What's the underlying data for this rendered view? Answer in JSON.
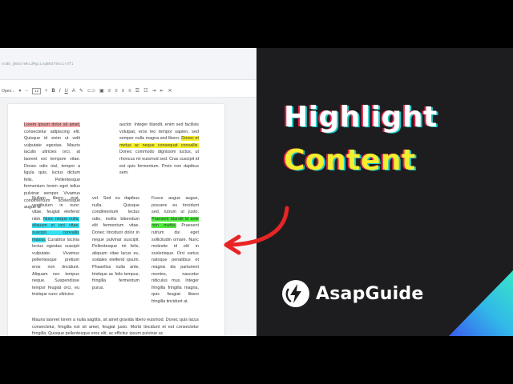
{
  "editor": {
    "url": "ocBE_Q6GorWkLdMgcLsgB0d79Gcir4fi",
    "toolbar": {
      "block_format": "Open...",
      "font_size": "12",
      "bold": "B",
      "italic": "I",
      "underline": "U"
    },
    "paragraphs": {
      "p1_highlight": "Lorem ipsum dolor sit amet,",
      "p1_rest": " consectetur adipiscing elit. Quisque id enim ut velit vulputate egestas. Mauris iaculis ultricies orci, at laoreet est tempore vitae. Donec odio nisl, tempor a ligula quis, luctus dictum felis. Pellentesque fermentum lorem eget tellus pulvinar semper. Vivamus condimentum scelerisque augue id",
      "p2_before": "auctor. Integer blandit, enim sed facilisis volutpat, eros leo tempor sapien, sed semper nulla magna sed libero. ",
      "p2_highlight": "Donec et metus ac neque consequat convallis.",
      "p2_rest": " Donec commodo dignissim luctus, ut rhoncus mi euismod sed. Cras suscipit id est quis fermentum. Proin non dapibus sem.",
      "p3_before": "Nullam libero erat, vestibulum in nunc vitae, feugiat eleifend nibh. ",
      "p3_highlight": "Nunc neque nulla, aliquam et orci vitae, suscipit convallis massa.",
      "p3_rest": " Curabitur lacinia lectus egestas suscipit vulputate. Vivamus pellentesque pretium eros non tincidunt. Aliquam nec tempus neque. Suspendisse tempor feugiat orci, eu tristique nunc ultricies",
      "p4": "vel. Sed eu dapibus nulla. Quisque condimentum lectus odio, mollis bibendum elit fermentum vitae. Donec tincidunt dolor in neque pulvinar suscipit. Pellentesque mi felis, aliquam vitae lacus eu, sodales eleifend ipsum. Phasellus nulla ante, tristique ac felis tempus, fringilla fermentum purus.",
      "p5_before": "Fusce augue augue, posuere eu tincidunt sed, rutrum ut justo. ",
      "p5_highlight": "Praesent blandit id ante non mattis.",
      "p5_rest": " Praesent rutrum dui eget sollicitudin ornare. Nunc molestie id elit in scelerisque. Orci varius natoque penatibus et magnis dis parturient montes, nascetur ridiculus mus. Integer fringilla fringilla magna, quis feugiat libero fringilla tincidunt at.",
      "p6": "Mauris laoreet lorem a nulla sagittis, sit amet gravida libero euismod. Donec quis lacus consectetur, fringilla est sit amet, feugiat justo. Morbi tincidunt et est consectetur fringilla. Quisque pellentesque eros elit, ac efficitur ipsum pulvinar ac."
    }
  },
  "panel": {
    "title_line1": "Highlight",
    "title_line2": "Content",
    "brand_name": "AsapGuide",
    "logo_icon": "lightning-bolt-icon"
  },
  "colors": {
    "highlight_red": "#f2a8a8",
    "highlight_yellow": "#f7f02b",
    "highlight_cyan": "#35e0f0",
    "highlight_green": "#4dec3c",
    "title_yellow": "#f4ef2e",
    "arrow_red": "#e82424",
    "panel_bg": "#1d1d1f"
  }
}
